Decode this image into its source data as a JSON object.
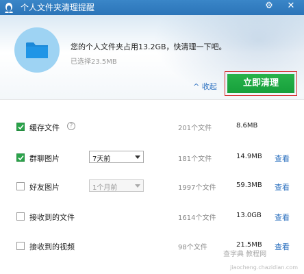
{
  "window": {
    "title": "个人文件夹清理提醒"
  },
  "header": {
    "message": "您的个人文件夹占用13.2GB，快清理一下吧。",
    "selected": "已选择23.5MB",
    "collapse_label": "收起",
    "clean_button": "立即清理"
  },
  "items": [
    {
      "label": "缓存文件",
      "checked": true,
      "count": "201个文件",
      "size": "8.6MB",
      "view": ""
    },
    {
      "label": "群聊图片",
      "checked": true,
      "select": "7天前",
      "count": "181个文件",
      "size": "14.9MB",
      "view": "查看"
    },
    {
      "label": "好友图片",
      "checked": false,
      "select": "1个月前",
      "count": "1997个文件",
      "size": "59.3MB",
      "view": "查看"
    },
    {
      "label": "接收到的文件",
      "checked": false,
      "count": "1614个文件",
      "size": "13.0GB",
      "view": "查看"
    },
    {
      "label": "接收到的视频",
      "checked": false,
      "count": "98个文件",
      "size": "21.5MB",
      "view": "查看"
    }
  ],
  "watermark": {
    "line1": "查字典 教程网",
    "line2": "jiaocheng.chazidian.com"
  },
  "colors": {
    "titlebar": "#2b74b8",
    "accent_green": "#1aa53e",
    "link_blue": "#2a6fbf",
    "highlight_red": "#d42a2a"
  }
}
